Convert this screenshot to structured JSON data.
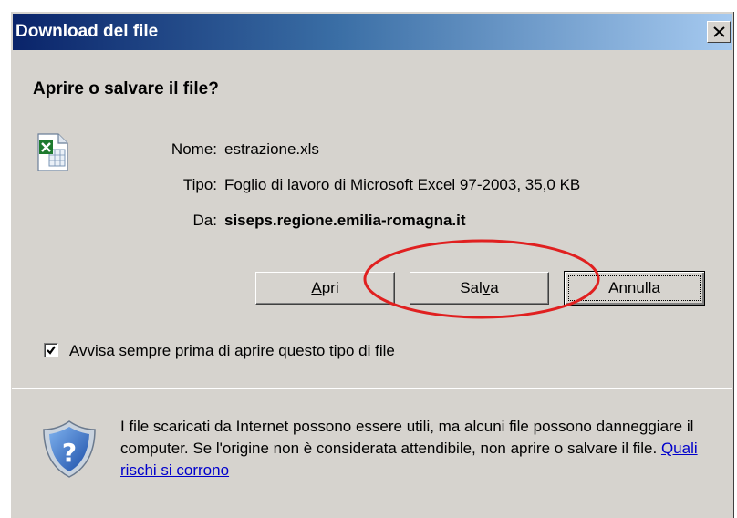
{
  "window": {
    "title": "Download del file",
    "close_glyph": "×"
  },
  "dialog": {
    "heading": "Aprire o salvare il file?",
    "file_icon": "excel-file-icon",
    "fields": {
      "name_label": "Nome:",
      "name_value": "estrazione.xls",
      "type_label": "Tipo:",
      "type_value": "Foglio di lavoro di Microsoft Excel 97-2003, 35,0 KB",
      "from_label": "Da:",
      "from_value": "siseps.regione.emilia-romagna.it"
    },
    "buttons": {
      "open": {
        "pre": "",
        "ul": "A",
        "post": "pri"
      },
      "save": {
        "pre": "Sal",
        "ul": "v",
        "post": "a"
      },
      "cancel": {
        "label": "Annulla"
      }
    },
    "checkbox": {
      "checked": true,
      "label_pre": "Avvi",
      "label_ul": "s",
      "label_post": "a sempre prima di aprire questo tipo di file"
    },
    "warning": {
      "icon": "shield-question-icon",
      "text": "I file scaricati da Internet possono essere utili, ma alcuni file possono danneggiare il computer. Se l'origine non è considerata attendibile, non aprire o salvare il file. ",
      "link": "Quali rischi si corrono"
    }
  },
  "colors": {
    "dialog_bg": "#d6d3ce",
    "title_start": "#0a246a",
    "title_end": "#a6caf0",
    "annotation_red": "#e02020",
    "link": "#0000cc"
  }
}
